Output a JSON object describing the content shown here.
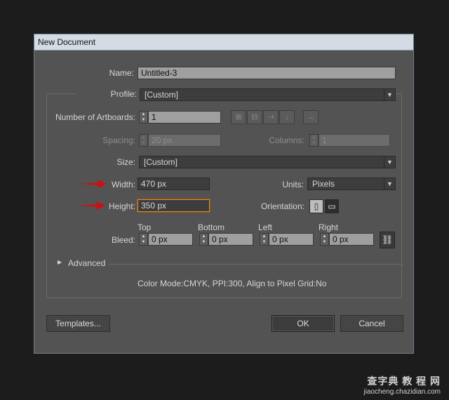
{
  "window": {
    "title": "New Document"
  },
  "name": {
    "label": "Name:",
    "value": "Untitled-3"
  },
  "profile": {
    "label": "Profile:",
    "value": "[Custom]"
  },
  "artboards": {
    "label": "Number of Artboards:",
    "value": "1"
  },
  "spacing": {
    "label": "Spacing:",
    "value": "20 px"
  },
  "columns": {
    "label": "Columns:",
    "value": "1"
  },
  "size": {
    "label": "Size:",
    "value": "[Custom]"
  },
  "width": {
    "label": "Width:",
    "value": "470 px"
  },
  "units": {
    "label": "Units:",
    "value": "Pixels"
  },
  "height": {
    "label": "Height:",
    "value": "350 px"
  },
  "orientation": {
    "label": "Orientation:"
  },
  "bleed": {
    "label": "Bleed:",
    "top": {
      "label": "Top",
      "value": "0 px"
    },
    "bottom": {
      "label": "Bottom",
      "value": "0 px"
    },
    "left": {
      "label": "Left",
      "value": "0 px"
    },
    "right": {
      "label": "Right",
      "value": "0 px"
    }
  },
  "advanced": {
    "label": "Advanced"
  },
  "info": "Color Mode:CMYK, PPI:300, Align to Pixel Grid:No",
  "buttons": {
    "templates": "Templates...",
    "ok": "OK",
    "cancel": "Cancel"
  },
  "watermark": {
    "line1": "查字典 教 程 网",
    "line2": "jiaocheng.chazidian.com"
  },
  "colors": {
    "annotation_arrow": "#cc1111",
    "focus_ring": "#d98b2b",
    "dialog_bg": "#535353"
  }
}
